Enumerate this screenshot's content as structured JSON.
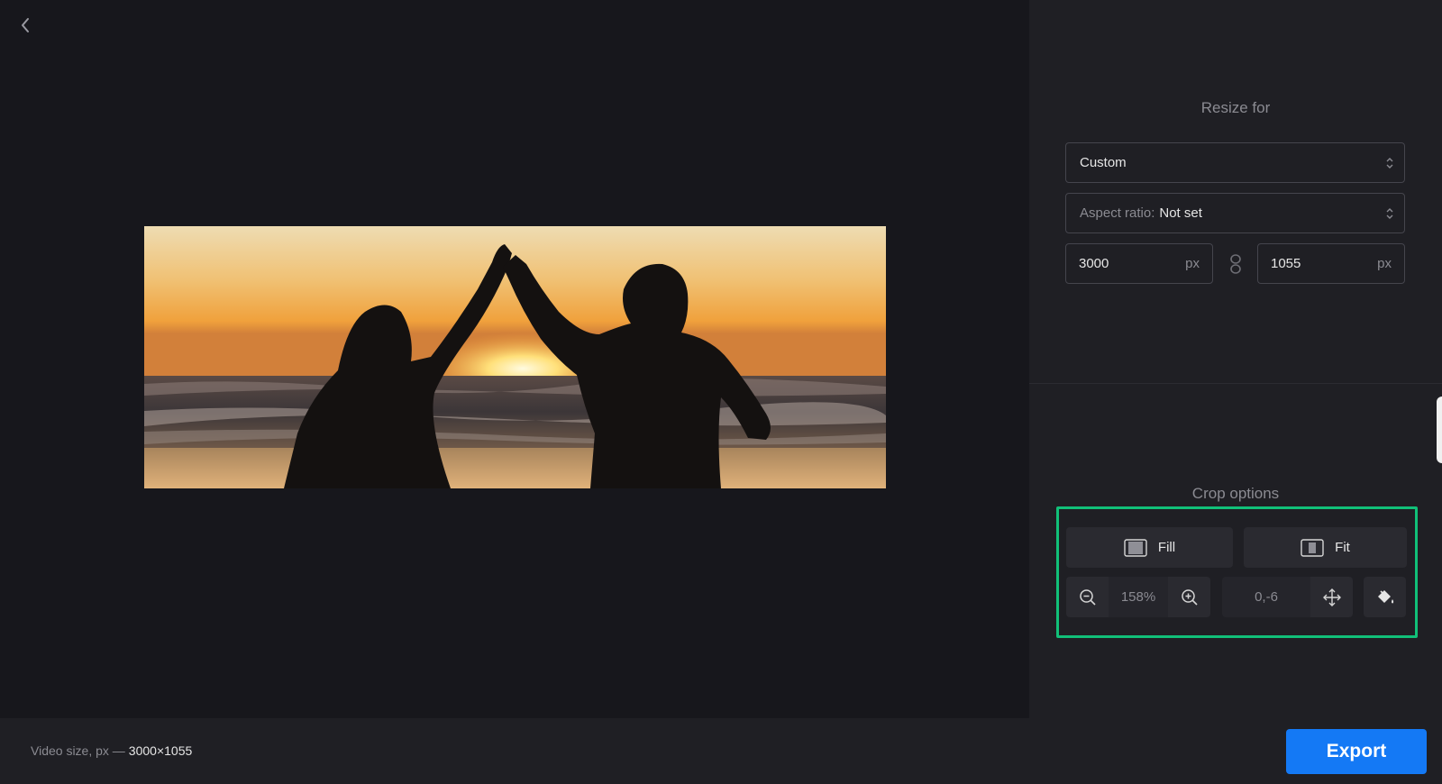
{
  "resize": {
    "title": "Resize for",
    "preset_value": "Custom",
    "aspect_label": "Aspect ratio:",
    "aspect_value": "Not set",
    "width_value": "3000",
    "height_value": "1055",
    "unit": "px"
  },
  "crop": {
    "title": "Crop options",
    "fill_label": "Fill",
    "fit_label": "Fit",
    "zoom_value": "158%",
    "position_value": "0,-6"
  },
  "footer": {
    "video_size_label": "Video size, px —",
    "video_size_value": "3000×1055",
    "export_label": "Export"
  },
  "colors": {
    "accent": "#1479f5",
    "highlight": "#11c079",
    "background": "#17171c",
    "panel": "#1f1f24"
  },
  "icons": {
    "back": "chevron-left-icon",
    "link": "chain-link-icon",
    "fill": "fill-crop-icon",
    "fit": "fit-crop-icon",
    "zoom_out": "zoom-out-icon",
    "zoom_in": "zoom-in-icon",
    "move": "move-arrows-icon",
    "background_fill": "paint-bucket-icon"
  }
}
